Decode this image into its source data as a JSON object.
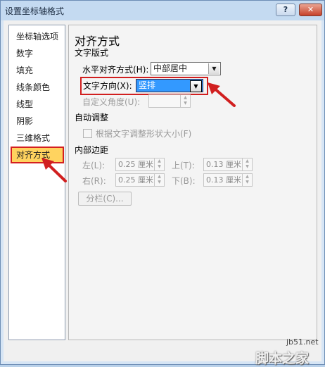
{
  "window": {
    "title": "设置坐标轴格式"
  },
  "titlebar": {
    "help_label": "?",
    "close_label": "✕"
  },
  "nav": {
    "items": [
      {
        "label": "坐标轴选项"
      },
      {
        "label": "数字"
      },
      {
        "label": "填充"
      },
      {
        "label": "线条颜色"
      },
      {
        "label": "线型"
      },
      {
        "label": "阴影"
      },
      {
        "label": "三维格式"
      },
      {
        "label": "对齐方式"
      }
    ],
    "selected": "对齐方式"
  },
  "panel": {
    "heading": "对齐方式",
    "text_layout": {
      "section_label": "文字版式",
      "h_align_label": "水平对齐方式(H):",
      "h_align_value": "中部居中",
      "text_dir_label": "文字方向(X):",
      "text_dir_value": "竖排",
      "custom_angle_label": "自定义角度(U):",
      "custom_angle_value": ""
    },
    "autofit": {
      "section_label": "自动调整",
      "resize_shape_label": "根据文字调整形状大小(F)"
    },
    "margins": {
      "section_label": "内部边距",
      "left_label": "左(L):",
      "left_value": "0.25 厘米",
      "top_label": "上(T):",
      "top_value": "0.13 厘米",
      "right_label": "右(R):",
      "right_value": "0.25 厘米",
      "bottom_label": "下(B):",
      "bottom_value": "0.13 厘米"
    },
    "columns_button": "分栏(C)..."
  },
  "watermark": {
    "url": "jb51.net",
    "brand": "脚本之家"
  },
  "colors": {
    "highlight_red": "#d11f1f",
    "selected_nav": "#ffd35f",
    "select_highlight": "#3399ff"
  }
}
